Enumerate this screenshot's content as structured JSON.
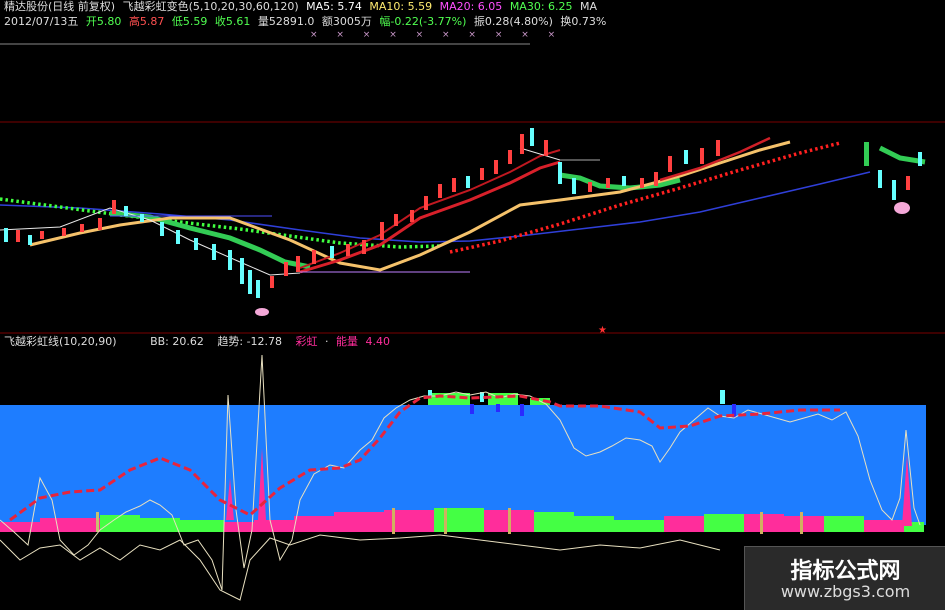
{
  "header": {
    "stock": "精达股份(日线 前复权)",
    "indicator_name": "飞越彩虹变色(5,10,20,30,60,120)",
    "ma5": "MA5: 5.74",
    "ma10": "MA10: 5.59",
    "ma20": "MA20: 6.05",
    "ma30": "MA30: 6.25",
    "ma_more": "MA",
    "date": "2012/07/13五",
    "open": "开5.80",
    "high": "高5.87",
    "low": "低5.59",
    "close": "收5.61",
    "volume": "量52891.0",
    "amount": "额3005万",
    "change": "幅-0.22(-3.77%)",
    "amplitude": "振0.28(4.80%)",
    "turnover": "换0.73%",
    "marks": "× × × × × × × × × ×"
  },
  "indicator": {
    "name": "飞越彩虹线(10,20,90)",
    "bb": "BB: 20.62",
    "trend": "趋势: -12.78",
    "rainbow": "彩虹",
    "sep": "·",
    "energy_label": "能量",
    "energy_value": "4.40"
  },
  "watermark": {
    "title": "指标公式网",
    "url": "www.zbgs3.com"
  },
  "colors": {
    "background": "#000000",
    "up_candle": "#ff4040",
    "down_candle": "#66ffff",
    "indicator_band": "#1e7dff",
    "green_bar": "#44ff44",
    "magenta_bar": "#ff2d9b",
    "white_line": "#e8e0c0",
    "red_line": "#e8243c"
  }
}
